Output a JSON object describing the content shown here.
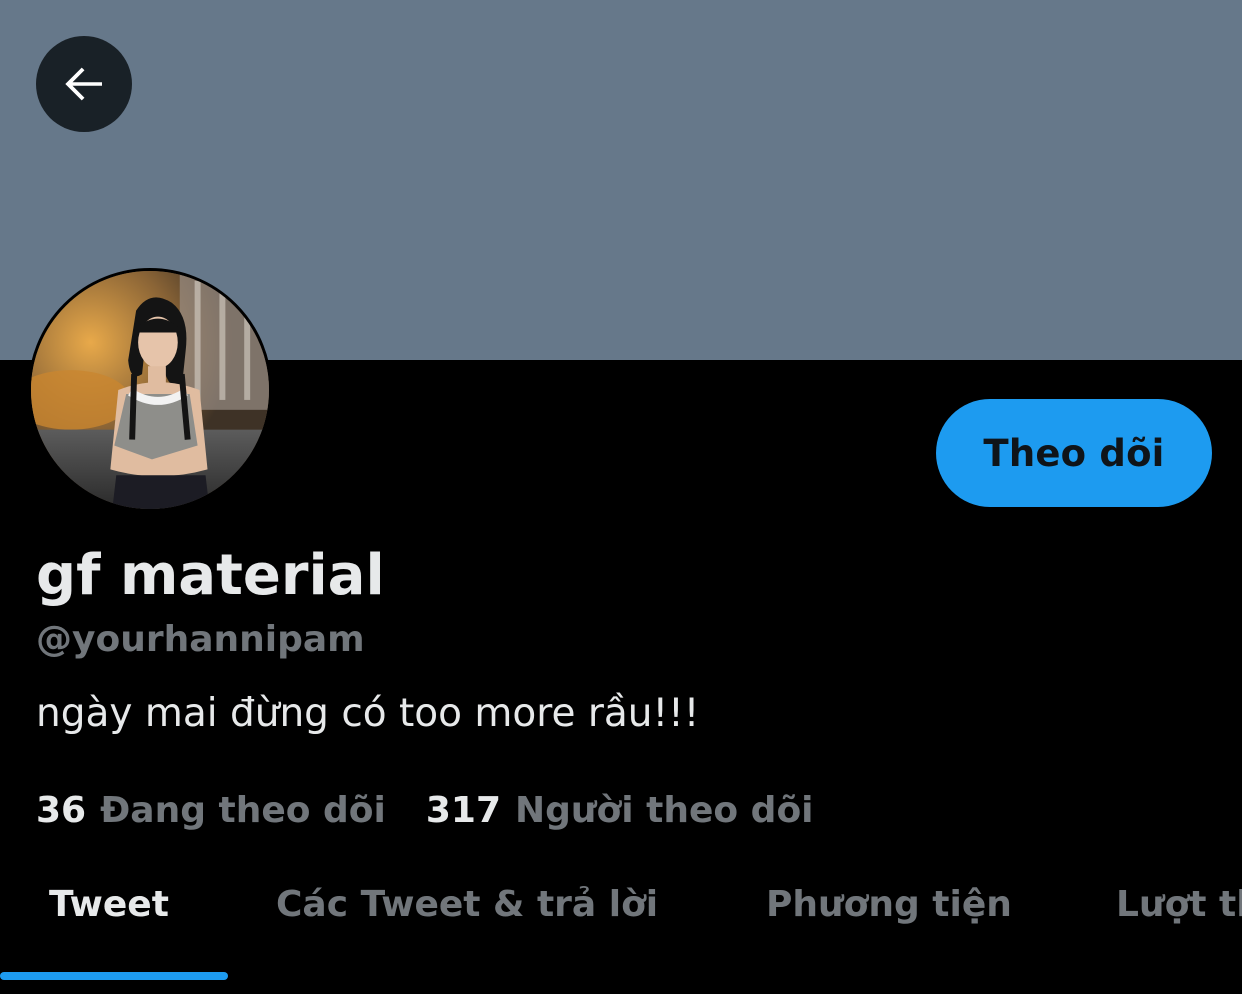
{
  "colors": {
    "banner": "#66788a",
    "accent": "#1d9bf0",
    "background": "#000000",
    "primary_text": "#e7e9ea",
    "secondary_text": "#71767b"
  },
  "header": {
    "back_icon": "arrow-left-icon"
  },
  "profile": {
    "display_name": "gf material",
    "handle": "@yourhannipam",
    "bio": "ngày mai đừng có too more rầu!!!",
    "follow_label": "Theo dõi"
  },
  "stats": {
    "following_count": "36",
    "following_label": "Đang theo dõi",
    "followers_count": "317",
    "followers_label": "Người theo dõi"
  },
  "tabs": [
    {
      "label": "Tweet",
      "active": true
    },
    {
      "label": "Các Tweet & trả lời",
      "active": false
    },
    {
      "label": "Phương tiện",
      "active": false
    },
    {
      "label": "Lượt thích",
      "active": false
    }
  ]
}
